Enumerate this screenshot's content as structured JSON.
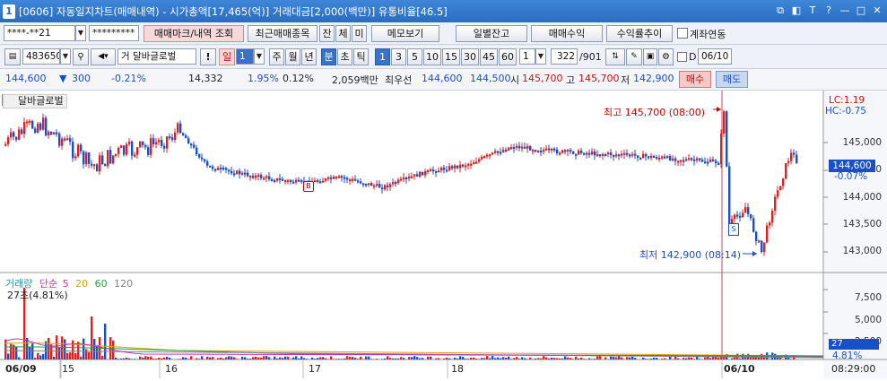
{
  "window": {
    "num": "1",
    "title": "[0606] 자동일지차트(매매내역) - 시가총액[17,465(억)] 거래대금[2,000(백만)] 유통비율[46.5]",
    "controls": [
      "⧉",
      "◧",
      "T",
      "?",
      "—",
      "□",
      "✕"
    ]
  },
  "toolbar1": {
    "account": "****-**21",
    "password": "*********",
    "btn_trade_mark": "매매마크/내역 조회",
    "btn_recent": "최근매매종목",
    "btn_jan": "잔",
    "btn_che": "체",
    "btn_mi": "미",
    "btn_memo": "메모보기",
    "btn_daily": "일별잔고",
    "btn_profit": "매매수익",
    "btn_rate": "수익률추이",
    "chk_link": "계좌연동"
  },
  "toolbar2": {
    "code": "483650",
    "name": "거 달바글로벌",
    "excl": "!",
    "period": "일",
    "period_num": "1",
    "tabs": [
      "주",
      "월",
      "년",
      "분",
      "초",
      "틱"
    ],
    "active_tab": "분",
    "intervals": [
      "1",
      "3",
      "5",
      "10",
      "15",
      "30",
      "45",
      "60"
    ],
    "active_interval": "1",
    "custom": "1",
    "count": "322",
    "total": "/901",
    "chk_d": "D",
    "date": "06/10"
  },
  "quote": {
    "price": "144,600",
    "arrow": "▼",
    "change": "300",
    "pct": "-0.21%",
    "vol": "14,332",
    "vol_pct": "1.95%",
    "turn": "0.12%",
    "amount": "2,059백만",
    "best_label": "최우선",
    "ask": "144,600",
    "bid": "144,500",
    "open_label": "시",
    "open": "145,700",
    "high_label": "고",
    "high": "145,700",
    "low_label": "저",
    "low": "142,900",
    "buy": "매수",
    "sell": "매도"
  },
  "chart": {
    "name": "달바글로벌",
    "lc": "LC:1.19",
    "hc": "HC:-0.75",
    "max_label": "최고 145,700 (08:00)",
    "min_label": "최저 142,900 (08:14)",
    "price_ticks": [
      "145,000",
      "144,500",
      "144,000",
      "143,500",
      "143,000"
    ],
    "cur_price": "144,600",
    "cur_pct": "-0.07%",
    "marker_b": "B",
    "marker_s": "S",
    "vol_title": "거래량",
    "ma_label": "단순",
    "ma": [
      "5",
      "20",
      "60",
      "120"
    ],
    "vol_max": "27초(4.81%)",
    "vol_ticks": [
      "7,500",
      "5,000",
      "2,500"
    ],
    "vol_cur": "27",
    "vol_cur_pct": "4.81%",
    "dates": [
      "06/09",
      "15",
      "16",
      "17",
      "18",
      "06/10"
    ],
    "time": "08:29:00",
    "colors": {
      "up": "#e02020",
      "down": "#1a4fc8",
      "ma5": "#c030c0",
      "ma20": "#d8a000",
      "ma60": "#20a040",
      "ma120": "#808080"
    }
  }
}
